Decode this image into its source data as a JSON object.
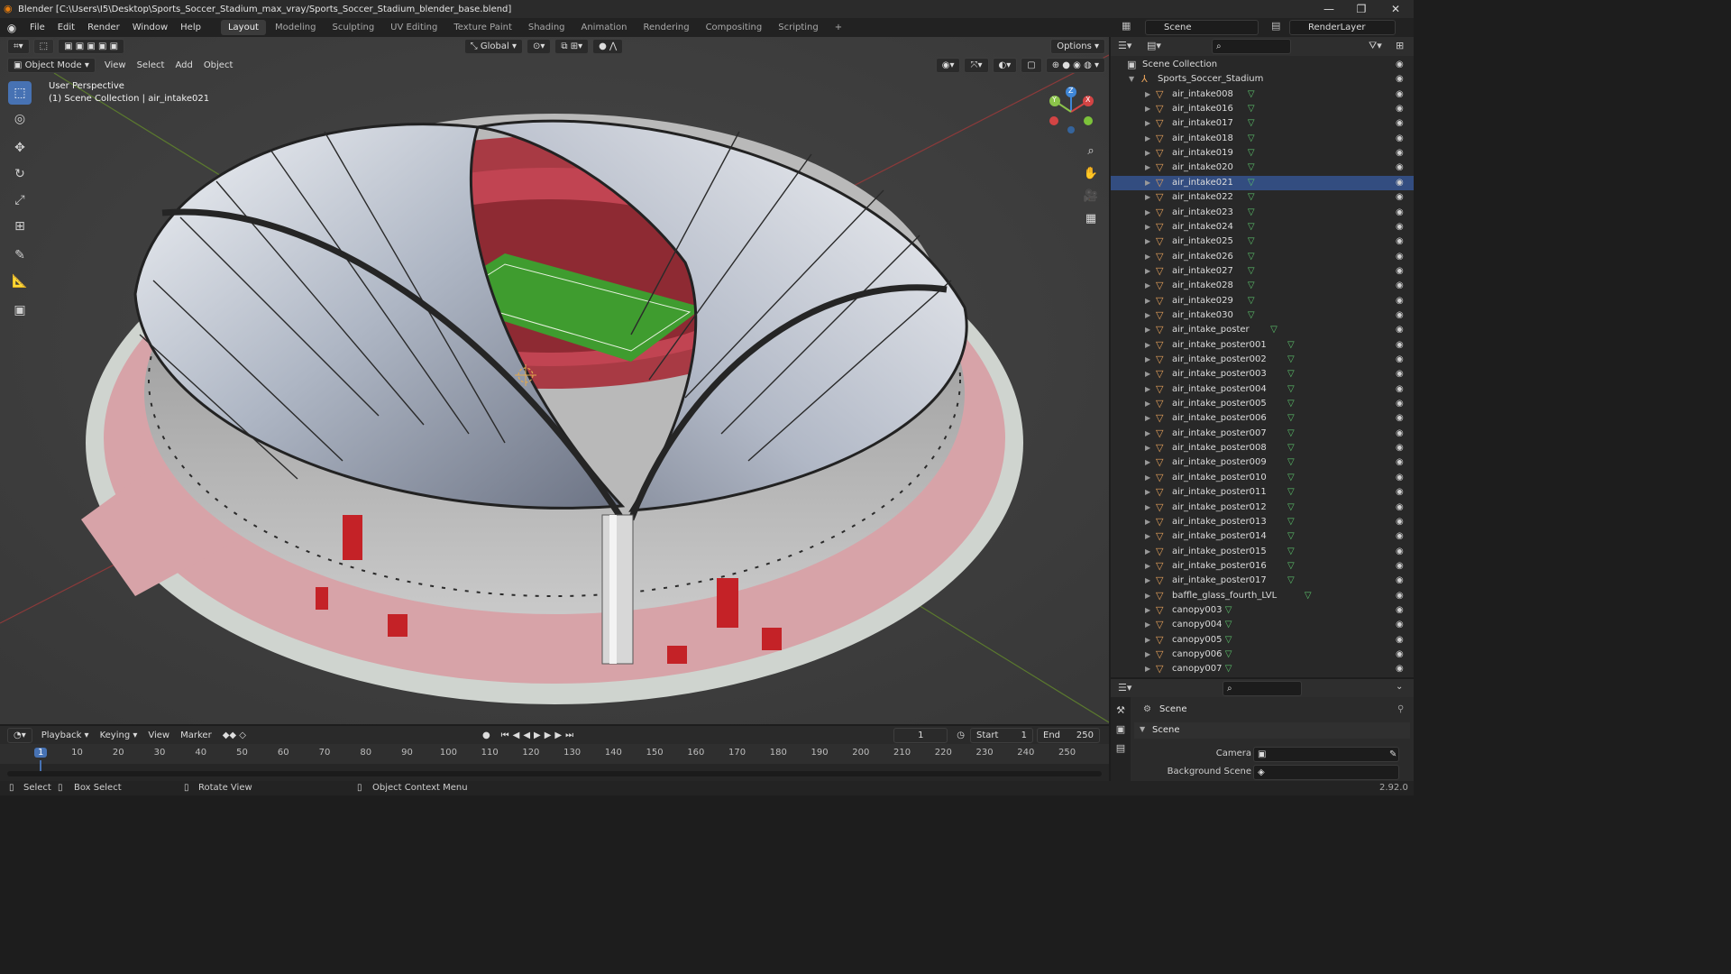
{
  "window": {
    "title": "Blender [C:\\Users\\I5\\Desktop\\Sports_Soccer_Stadium_max_vray/Sports_Soccer_Stadium_blender_base.blend]"
  },
  "menu": [
    "File",
    "Edit",
    "Render",
    "Window",
    "Help"
  ],
  "workspaces": [
    "Layout",
    "Modeling",
    "Sculpting",
    "UV Editing",
    "Texture Paint",
    "Shading",
    "Animation",
    "Rendering",
    "Compositing",
    "Scripting"
  ],
  "active_workspace": "Layout",
  "scene": {
    "name": "Scene",
    "view_layer": "RenderLayer"
  },
  "viewport": {
    "mode": "Object Mode",
    "menus": [
      "View",
      "Select",
      "Add",
      "Object"
    ],
    "orientation": "Global",
    "options_label": "Options",
    "perspective_label": "User Perspective",
    "collection_label": "(1) Scene Collection | air_intake021",
    "gizmo_axes": {
      "x": "X",
      "y": "Y",
      "z": "Z"
    }
  },
  "outliner": {
    "root": "Scene Collection",
    "collection": "Sports_Soccer_Stadium",
    "selected": "air_intake021",
    "items": [
      "air_intake008",
      "air_intake016",
      "air_intake017",
      "air_intake018",
      "air_intake019",
      "air_intake020",
      "air_intake021",
      "air_intake022",
      "air_intake023",
      "air_intake024",
      "air_intake025",
      "air_intake026",
      "air_intake027",
      "air_intake028",
      "air_intake029",
      "air_intake030",
      "air_intake_poster",
      "air_intake_poster001",
      "air_intake_poster002",
      "air_intake_poster003",
      "air_intake_poster004",
      "air_intake_poster005",
      "air_intake_poster006",
      "air_intake_poster007",
      "air_intake_poster008",
      "air_intake_poster009",
      "air_intake_poster010",
      "air_intake_poster011",
      "air_intake_poster012",
      "air_intake_poster013",
      "air_intake_poster014",
      "air_intake_poster015",
      "air_intake_poster016",
      "air_intake_poster017",
      "baffle_glass_fourth_LVL",
      "canopy003",
      "canopy004",
      "canopy005",
      "canopy006",
      "canopy007"
    ]
  },
  "properties": {
    "header": "Scene",
    "panel": "Scene",
    "camera_label": "Camera",
    "background_label": "Background Scene"
  },
  "timeline": {
    "menus": [
      "Playback",
      "Keying",
      "View",
      "Marker"
    ],
    "current_frame": "1",
    "start_label": "Start",
    "start": "1",
    "end_label": "End",
    "end": "250",
    "ruler": [
      "1",
      "10",
      "20",
      "30",
      "40",
      "50",
      "60",
      "70",
      "80",
      "90",
      "100",
      "110",
      "120",
      "130",
      "140",
      "150",
      "160",
      "170",
      "180",
      "190",
      "200",
      "210",
      "220",
      "230",
      "240",
      "250"
    ]
  },
  "status": {
    "select": "Select",
    "box_select": "Box Select",
    "rotate": "Rotate View",
    "context": "Object Context Menu",
    "version": "2.92.0"
  },
  "colors": {
    "accent": "#4772b3",
    "selected_row": "#334d80",
    "object_icon": "#e7a25b",
    "mesh_icon": "#5bc26b"
  }
}
